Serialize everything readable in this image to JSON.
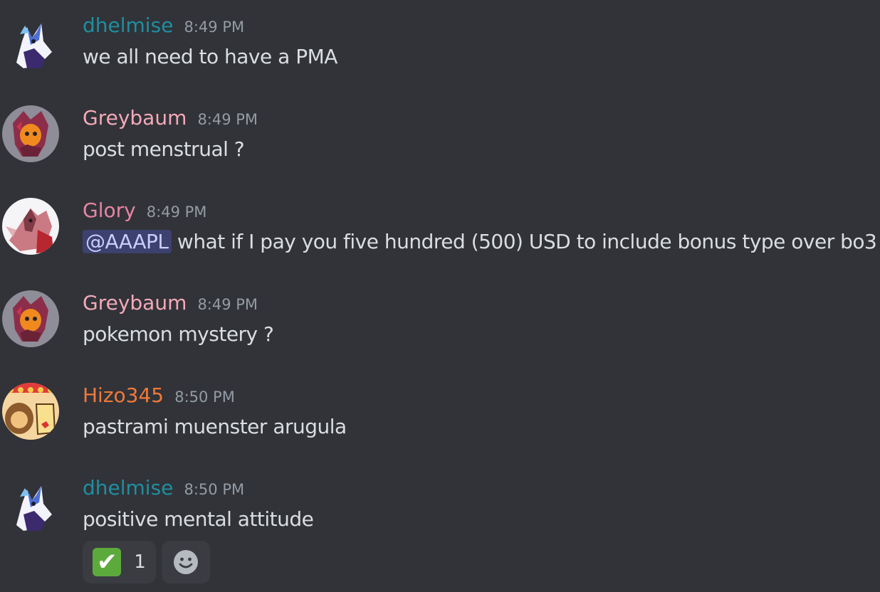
{
  "colors": {
    "background": "#313338",
    "text": "#dbdee1",
    "timestamp": "#949ba4",
    "mention_bg": "#3c4270",
    "mention_text": "#c9cdfb"
  },
  "messages": [
    {
      "username": "dhelmise",
      "user_color": "#1e8fa0",
      "time": "8:49 PM",
      "text": "we all need to have a PMA",
      "avatar": "blue-fox-avatar"
    },
    {
      "username": "Greybaum",
      "user_color": "#f4a9b8",
      "time": "8:49 PM",
      "text": "post menstrual ?",
      "avatar": "orange-monster-avatar"
    },
    {
      "username": "Glory",
      "user_color": "#e884a2",
      "time": "8:49 PM",
      "mention": "@AAAPL",
      "text": " what if I pay you five hundred (500) USD to include bonus type over bo3",
      "avatar": "red-creature-avatar"
    },
    {
      "username": "Greybaum",
      "user_color": "#f4a9b8",
      "time": "8:49 PM",
      "text": "pokemon mystery ?",
      "avatar": "orange-monster-avatar"
    },
    {
      "username": "Hizo345",
      "user_color": "#f0793a",
      "time": "8:50 PM",
      "text": "pastrami muenster arugula",
      "avatar": "cartoon-faces-avatar"
    },
    {
      "username": "dhelmise",
      "user_color": "#1e8fa0",
      "time": "8:50 PM",
      "text": "positive mental attitude",
      "avatar": "blue-fox-avatar"
    }
  ],
  "reactions": [
    {
      "emoji": "✔",
      "icon": "check-mark-icon",
      "count": "1"
    }
  ],
  "add_reaction_icon": "smiley-face-icon"
}
